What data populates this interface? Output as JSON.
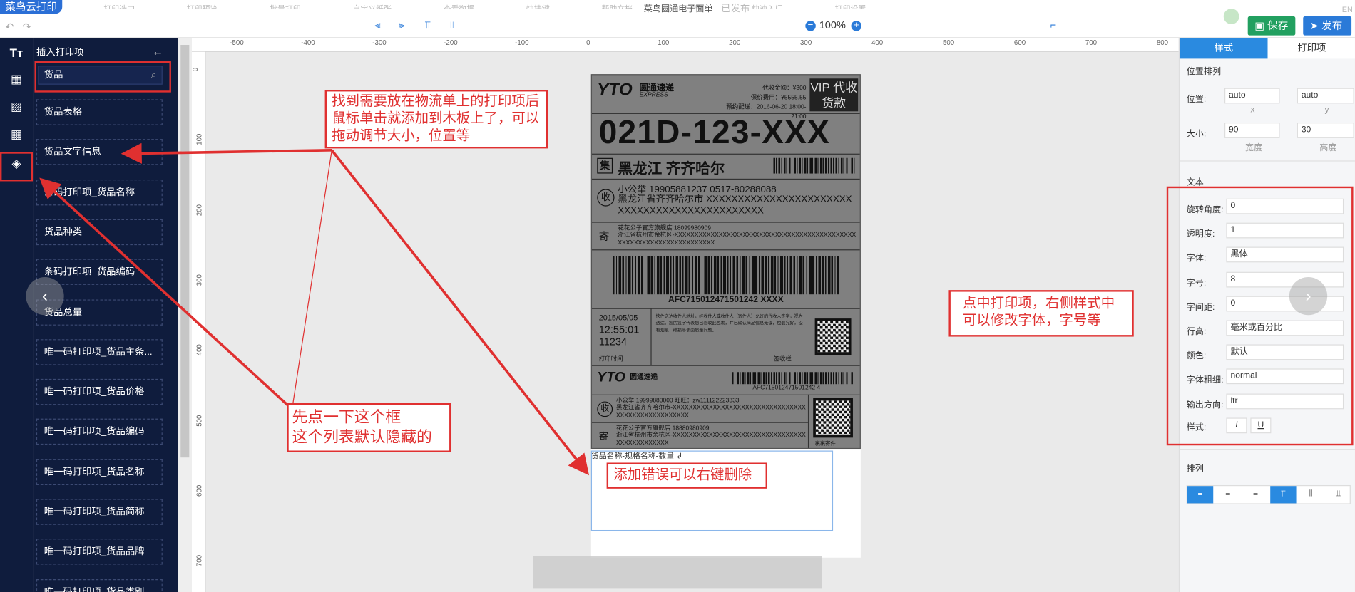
{
  "app": {
    "logo": "菜鸟云打印",
    "doc_title": "菜鸟圆通电子面单",
    "doc_status": "- 已发布",
    "ghost_menu": [
      "打印选中",
      "打印预览",
      "批量打印",
      "自定义纸张",
      "查看数据",
      "快捷键",
      "帮助文档",
      "反馈",
      "快速入门",
      "打印设置"
    ]
  },
  "toolbar": {
    "zoom": "100%",
    "save": "保存",
    "publish": "发布",
    "right_text": "EN"
  },
  "sidebar": {
    "title": "插入打印项",
    "search_value": "货品",
    "items": [
      "货品表格",
      "货品文字信息",
      "条码打印项_货品名称",
      "货品种类",
      "条码打印项_货品编码",
      "货品总量",
      "唯一码打印项_货品主条...",
      "唯一码打印项_货品价格",
      "唯一码打印项_货品编码",
      "唯一码打印项_货品名称",
      "唯一码打印项_货品简称",
      "唯一码打印项_货品品牌",
      "唯一码打印项_货品类别"
    ]
  },
  "ruler": {
    "h": [
      "-500",
      "-400",
      "-300",
      "-200",
      "-100",
      "0",
      "100",
      "200",
      "300",
      "400",
      "500",
      "600",
      "700",
      "800"
    ],
    "v": [
      "0",
      "100",
      "200",
      "300",
      "400",
      "500",
      "600",
      "700"
    ]
  },
  "label": {
    "brand_logo": "YTO",
    "brand_cn": "圆通速递",
    "brand_en": "EXPRESS",
    "cod_amount": "代收金额：¥300",
    "insured": "保价费用：¥5555.55",
    "appointment": "预约配送：2016-06-20 18:00-21:00",
    "vip": "VIP 代收货款",
    "sort_code": "021D-123-XXX",
    "collect_tag": "集",
    "dest": "黑龙江  齐齐哈尔",
    "recv_tag": "收",
    "recv_line": "小公举    19905881237    0517-80288088",
    "recv_addr": "黑龙江省齐齐哈尔市 XXXXXXXXXXXXXXXXXXXXXXXXXXXXXXXXXXXXXXXXXXXXXX",
    "send_tag": "寄",
    "send_line": "花花公子官方旗舰店  18099980909",
    "send_addr": "浙江省杭州市余杭区-XXXXXXXXXXXXXXXXXXXXXXXXXXXXXXXXXXXXXXXXXXXXXXXXXXXXXXXXXXXXXXXXXXXXX",
    "barcode_no": "AFC715012471501242 XXXX",
    "date": "2015/05/05",
    "time": "12:55:01",
    "code": "11234",
    "notice": "快件送达收件人地址，经收件人或收件人（寄件人）允许的代收人签字，视为送达。您的签字代表您已验收此包裹，并已确认商品信息无误，包装完好，没有划痕、破损等表面质量问题。",
    "print_time": "打印时间",
    "sign": "签收栏",
    "barcode_no2": "AFC715012471501242 4",
    "recv_line2": "小公举    19999880000    旺旺：zw111122223333",
    "recv_addr2": "黑龙江省齐齐哈尔市-XXXXXXXXXXXXXXXXXXXXXXXXXXXXXXXXXXXXXXXXXXXXXXXXXXX",
    "send_line2": "花花公子官方旗舰店  18880980909",
    "send_addr2": "浙江省杭州市余杭区-XXXXXXXXXXXXXXXXXXXXXXXXXXXXXXXXXXXXXXXXXXXXXX",
    "qr_caption": "裹裹寄件"
  },
  "canvas": {
    "goods_line": "货品名称-规格名称-数量 ↲"
  },
  "panel": {
    "tab_style": "样式",
    "tab_items": "打印项",
    "sec_position": "位置排列",
    "pos_label": "位置:",
    "pos_x": "auto",
    "pos_y": "auto",
    "x": "x",
    "y": "y",
    "size_label": "大小:",
    "w": "90",
    "h": "30",
    "w_label": "宽度",
    "h_label": "高度",
    "sec_text": "文本",
    "rows": [
      {
        "label": "旋转角度:",
        "value": "0"
      },
      {
        "label": "透明度:",
        "value": "1"
      },
      {
        "label": "字体:",
        "value": "黑体"
      },
      {
        "label": "字号:",
        "value": "8"
      },
      {
        "label": "字间距:",
        "value": "0"
      },
      {
        "label": "行高:",
        "value": "毫米或百分比"
      },
      {
        "label": "颜色:",
        "value": "默认"
      },
      {
        "label": "字体粗细:",
        "value": "normal"
      },
      {
        "label": "输出方向:",
        "value": "ltr"
      }
    ],
    "style_label": "样式:",
    "italic": "I",
    "underline": "U",
    "sec_align": "排列"
  },
  "annotations": {
    "a1": "找到需要放在物流单上的打印项后鼠标单击就添加到木板上了，可以拖动调节大小，位置等",
    "a2": "先点一下这个框\n这个列表默认隐藏的",
    "a3": "添加错误可以右键删除",
    "a4": "点中打印项，右侧样式中可以修改字体，字号等"
  },
  "colors": {
    "accent": "#2a7ad8",
    "dark_nav": "#0f1c3d",
    "annotation": "#e03030",
    "save": "#22a060"
  }
}
